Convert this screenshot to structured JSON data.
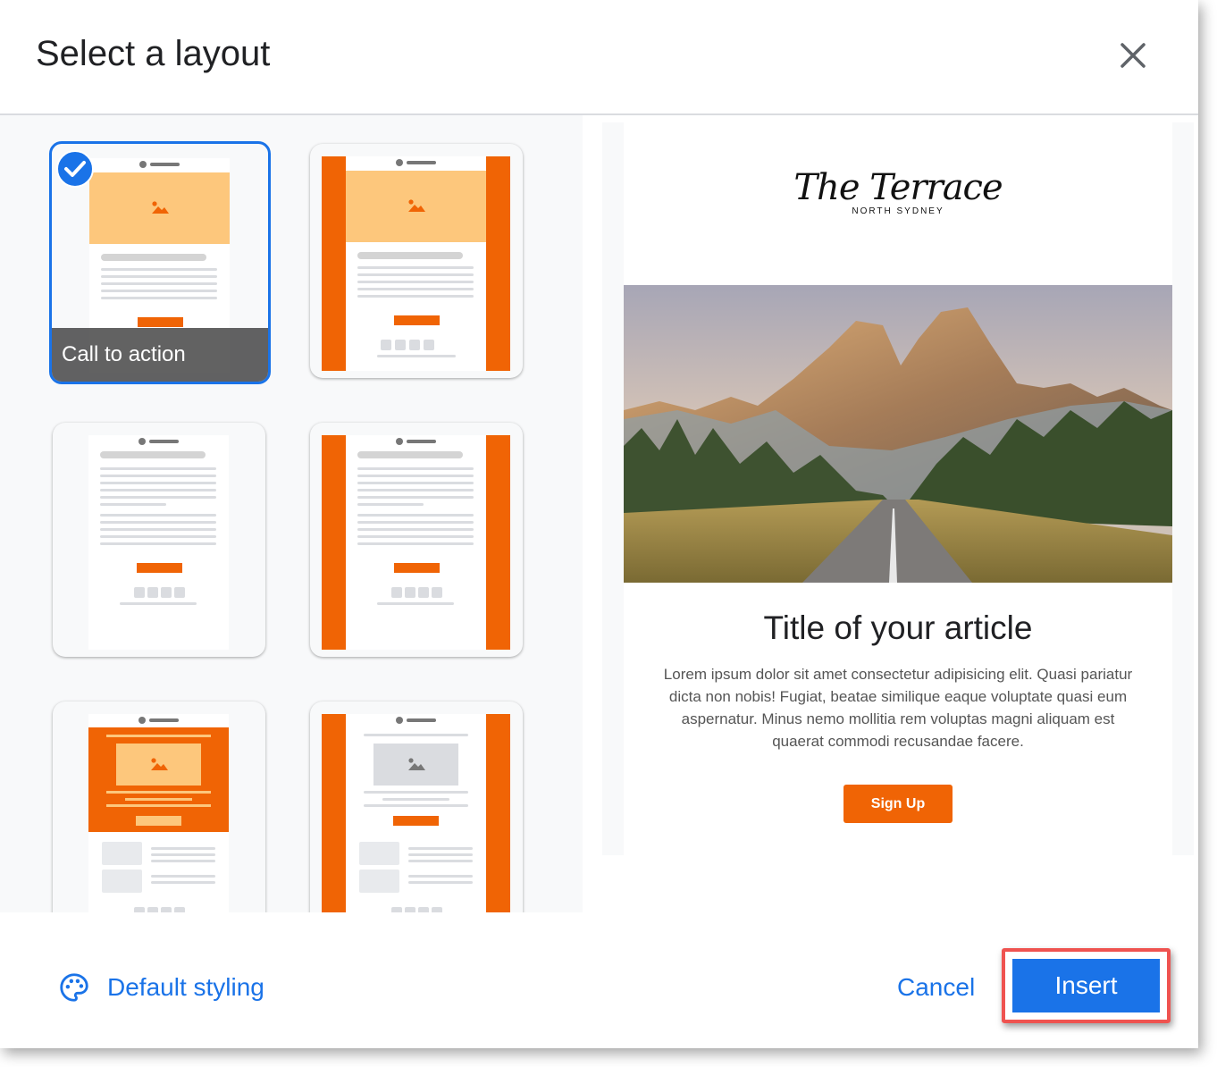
{
  "dialog": {
    "title": "Select a layout"
  },
  "layouts": [
    {
      "caption": "Call to action",
      "selected": true
    },
    {
      "caption": "",
      "selected": false
    },
    {
      "caption": "",
      "selected": false
    },
    {
      "caption": "",
      "selected": false
    },
    {
      "caption": "",
      "selected": false
    },
    {
      "caption": "",
      "selected": false
    }
  ],
  "preview": {
    "logo_main": "The Terrace",
    "logo_sub": "NORTH SYDNEY",
    "article_title": "Title of your article",
    "article_body": "Lorem ipsum dolor sit amet consectetur adipisicing elit. Quasi pariatur dicta non nobis! Fugiat, beatae similique eaque voluptate quasi eum aspernatur. Minus nemo mollitia rem voluptas magni aliquam est quaerat commodi recusandae facere.",
    "button_label": "Sign Up"
  },
  "footer": {
    "default_styling_label": "Default styling",
    "cancel_label": "Cancel",
    "insert_label": "Insert"
  },
  "colors": {
    "accent_blue": "#1a73e8",
    "brand_orange": "#f06405",
    "hero_peach": "#fdc77c",
    "highlight_red": "#ef5350"
  },
  "icons": [
    "close-icon",
    "checkmark-icon",
    "image-icon",
    "palette-icon"
  ]
}
